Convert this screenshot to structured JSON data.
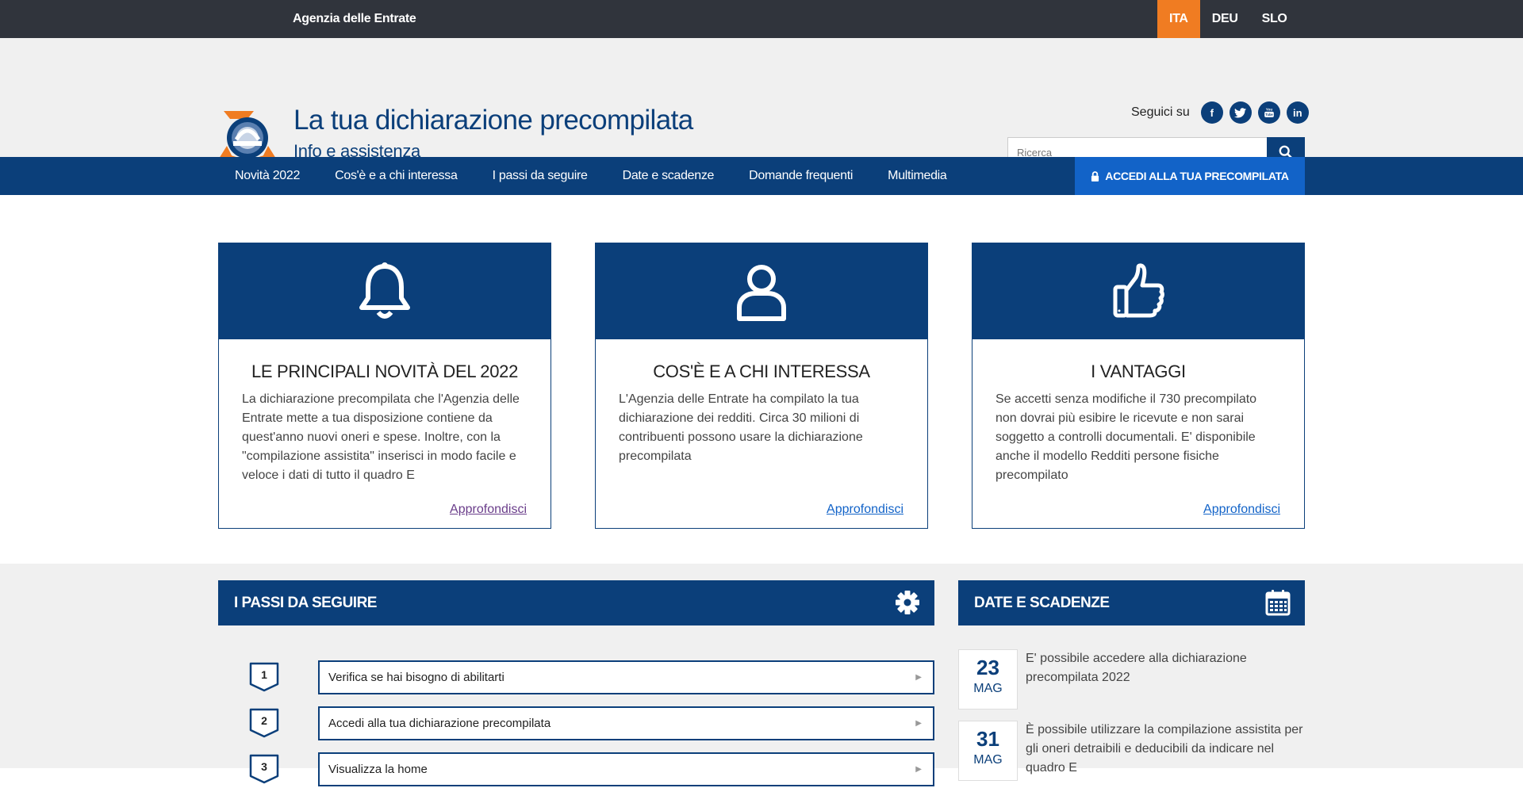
{
  "topbar": {
    "agency": "Agenzia delle Entrate",
    "languages": [
      "ITA",
      "DEU",
      "SLO"
    ],
    "active_language": "ITA"
  },
  "header": {
    "title": "La tua dichiarazione precompilata",
    "subtitle": "Info e assistenza",
    "social_label": "Seguici su",
    "social_icons": [
      "facebook-icon",
      "twitter-icon",
      "youtube-icon",
      "linkedin-icon"
    ],
    "search_placeholder": "Ricerca"
  },
  "nav": {
    "items": [
      "Novità 2022",
      "Cos'è e a chi interessa",
      "I passi da seguire",
      "Date e scadenze",
      "Domande frequenti",
      "Multimedia"
    ],
    "access_label": "ACCEDI ALLA TUA PRECOMPILATA"
  },
  "cards": [
    {
      "icon": "bell-icon",
      "title": "LE PRINCIPALI NOVITÀ DEL 2022",
      "text": "La dichiarazione precompilata che l'Agenzia delle Entrate mette a tua disposizione contiene da quest'anno nuovi oneri e spese. Inoltre, con la \"compilazione assistita\" inserisci in modo facile e veloce i dati di tutto il quadro E",
      "link": "Approfondisci"
    },
    {
      "icon": "user-icon",
      "title": "COS'È E A CHI INTERESSA",
      "text": "L'Agenzia delle Entrate ha compilato la tua dichiarazione dei redditi. Circa 30 milioni di contribuenti possono usare la dichiarazione precompilata",
      "link": "Approfondisci"
    },
    {
      "icon": "thumbs-up-icon",
      "title": "I VANTAGGI",
      "text": "Se accetti senza modifiche il 730 precompilato non dovrai più esibire le ricevute e non sarai soggetto a controlli documentali. E' disponibile anche il modello Redditi persone fisiche precompilato",
      "link": "Approfondisci"
    }
  ],
  "steps": {
    "title": "I PASSI DA SEGUIRE",
    "items": [
      {
        "num": "1",
        "label": "Verifica se hai bisogno di abilitarti"
      },
      {
        "num": "2",
        "label": "Accedi alla tua dichiarazione precompilata"
      },
      {
        "num": "3",
        "label": "Visualizza la home"
      }
    ]
  },
  "dates": {
    "title": "DATE E SCADENZE",
    "items": [
      {
        "day": "23",
        "month": "MAG",
        "text": "E' possibile accedere alla dichiarazione precompilata 2022"
      },
      {
        "day": "31",
        "month": "MAG",
        "text": "È possibile utilizzare la compilazione assistita per gli oneri detraibili e deducibili da indicare nel quadro E"
      }
    ]
  },
  "colors": {
    "primary": "#0b3f7a",
    "accent": "#f07c22",
    "access": "#1263c8",
    "topbar": "#30343c"
  }
}
